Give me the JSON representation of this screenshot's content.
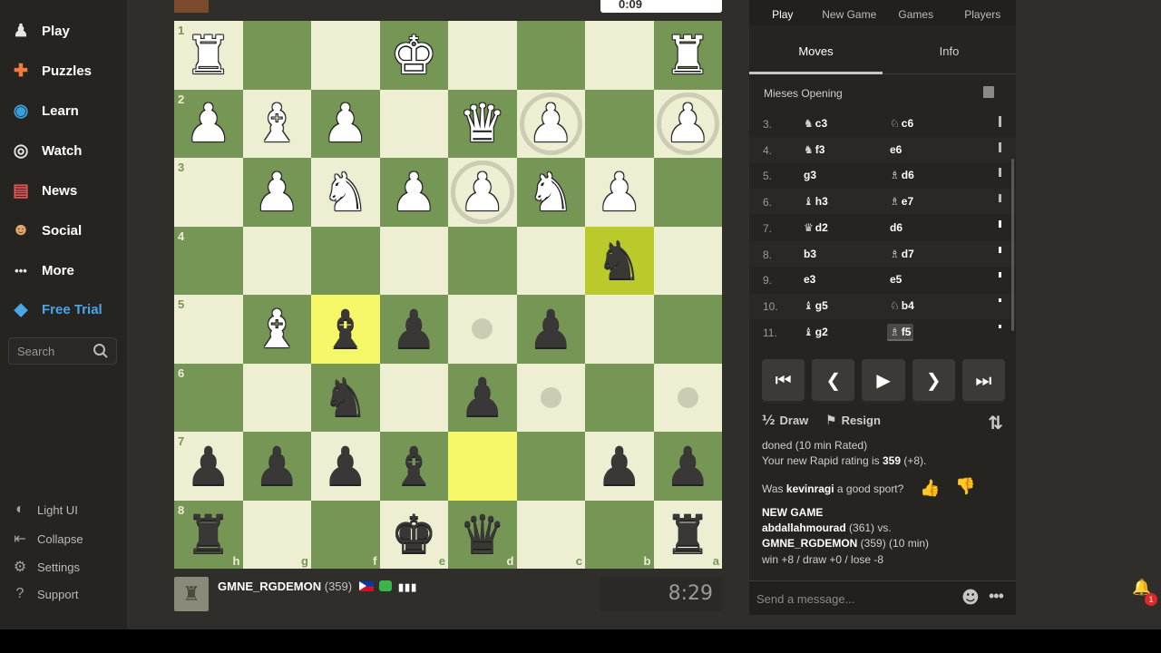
{
  "sidebar": {
    "items": [
      {
        "label": "Play",
        "icon": "play-pawn-icon",
        "glyph": "♟",
        "color": "#e6e6e6"
      },
      {
        "label": "Puzzles",
        "icon": "puzzle-icon",
        "glyph": "✚",
        "color": "#f07c3e"
      },
      {
        "label": "Learn",
        "icon": "learn-icon",
        "glyph": "◉",
        "color": "#3aa0dc"
      },
      {
        "label": "Watch",
        "icon": "binoculars-icon",
        "glyph": "◎",
        "color": "#e6e6e6"
      },
      {
        "label": "News",
        "icon": "newspaper-icon",
        "glyph": "▤",
        "color": "#e05252"
      },
      {
        "label": "Social",
        "icon": "people-icon",
        "glyph": "☻",
        "color": "#e2a76b"
      },
      {
        "label": "More",
        "icon": "more-dots-icon",
        "glyph": "•••",
        "color": "#e6e6e6"
      },
      {
        "label": "Free Trial",
        "icon": "diamond-icon",
        "glyph": "◆",
        "color": "#49a6e9"
      }
    ],
    "search_placeholder": "Search",
    "footer": [
      {
        "label": "Light UI",
        "icon": "light-ui-icon",
        "glyph": "◐"
      },
      {
        "label": "Collapse",
        "icon": "collapse-icon",
        "glyph": "⇤"
      },
      {
        "label": "Settings",
        "icon": "gear-icon",
        "glyph": "⚙"
      },
      {
        "label": "Support",
        "icon": "help-icon",
        "glyph": "?"
      }
    ]
  },
  "top_player": {
    "clock": "0:09"
  },
  "board": {
    "orientation": "black",
    "colors": {
      "light": "#eeeed2",
      "dark": "#769656",
      "highlight_light": "#f6f669",
      "highlight_dark": "#baca2b"
    },
    "rank_labels": [
      "1",
      "2",
      "3",
      "4",
      "5",
      "6",
      "7",
      "8"
    ],
    "file_labels": [
      "h",
      "g",
      "f",
      "e",
      "d",
      "c",
      "b",
      "a"
    ],
    "pieces": [
      {
        "sq": "h1",
        "glyph": "♜",
        "color": "white",
        "name": "white-rook"
      },
      {
        "sq": "e1",
        "glyph": "♚",
        "color": "white",
        "name": "white-king"
      },
      {
        "sq": "a1",
        "glyph": "♜",
        "color": "white",
        "name": "white-rook"
      },
      {
        "sq": "h2",
        "glyph": "♟",
        "color": "white",
        "name": "white-pawn"
      },
      {
        "sq": "g2",
        "glyph": "♝",
        "color": "white",
        "name": "white-bishop"
      },
      {
        "sq": "f2",
        "glyph": "♟",
        "color": "white",
        "name": "white-pawn"
      },
      {
        "sq": "d2",
        "glyph": "♛",
        "color": "white",
        "name": "white-queen"
      },
      {
        "sq": "c2",
        "glyph": "♟",
        "color": "white",
        "name": "white-pawn"
      },
      {
        "sq": "a2",
        "glyph": "♟",
        "color": "white",
        "name": "white-pawn"
      },
      {
        "sq": "g3",
        "glyph": "♟",
        "color": "white",
        "name": "white-pawn"
      },
      {
        "sq": "f3",
        "glyph": "♞",
        "color": "white",
        "name": "white-knight"
      },
      {
        "sq": "e3",
        "glyph": "♟",
        "color": "white",
        "name": "white-pawn"
      },
      {
        "sq": "d3",
        "glyph": "♟",
        "color": "white",
        "name": "white-pawn"
      },
      {
        "sq": "c3",
        "glyph": "♞",
        "color": "white",
        "name": "white-knight"
      },
      {
        "sq": "b3",
        "glyph": "♟",
        "color": "white",
        "name": "white-pawn"
      },
      {
        "sq": "g5",
        "glyph": "♝",
        "color": "white",
        "name": "white-bishop"
      },
      {
        "sq": "b4",
        "glyph": "♞",
        "color": "black",
        "name": "black-knight"
      },
      {
        "sq": "f5",
        "glyph": "♝",
        "color": "black",
        "name": "black-bishop"
      },
      {
        "sq": "e5",
        "glyph": "♟",
        "color": "black",
        "name": "black-pawn"
      },
      {
        "sq": "c5",
        "glyph": "♟",
        "color": "black",
        "name": "black-pawn"
      },
      {
        "sq": "f6",
        "glyph": "♞",
        "color": "black",
        "name": "black-knight"
      },
      {
        "sq": "d6",
        "glyph": "♟",
        "color": "black",
        "name": "black-pawn"
      },
      {
        "sq": "h7",
        "glyph": "♟",
        "color": "black",
        "name": "black-pawn"
      },
      {
        "sq": "g7",
        "glyph": "♟",
        "color": "black",
        "name": "black-pawn"
      },
      {
        "sq": "f7",
        "glyph": "♟",
        "color": "black",
        "name": "black-pawn"
      },
      {
        "sq": "e7",
        "glyph": "♝",
        "color": "black",
        "name": "black-bishop"
      },
      {
        "sq": "b7",
        "glyph": "♟",
        "color": "black",
        "name": "black-pawn"
      },
      {
        "sq": "a7",
        "glyph": "♟",
        "color": "black",
        "name": "black-pawn"
      },
      {
        "sq": "h8",
        "glyph": "♜",
        "color": "black",
        "name": "black-rook"
      },
      {
        "sq": "e8",
        "glyph": "♚",
        "color": "black",
        "name": "black-king"
      },
      {
        "sq": "d8",
        "glyph": "♛",
        "color": "black",
        "name": "black-queen"
      },
      {
        "sq": "a8",
        "glyph": "♜",
        "color": "black",
        "name": "black-rook"
      }
    ],
    "highlights": [
      "b4",
      "f5",
      "d7"
    ],
    "hint_dots": [
      "d5",
      "c6",
      "a6"
    ],
    "hint_rings": [
      "c2",
      "a2",
      "d3"
    ]
  },
  "bottom_player": {
    "name": "GMNE_RGDEMON",
    "rating": "(359)",
    "bars": "▮▮▮",
    "clock": "8:29"
  },
  "panel": {
    "top_tabs": [
      "Play",
      "New Game",
      "Games",
      "Players"
    ],
    "subtabs": [
      "Moves",
      "Info"
    ],
    "opening": "Mieses Opening",
    "moves": [
      {
        "n": "3.",
        "wg": "♞",
        "w": "c3",
        "bg": "♘",
        "b": "c6",
        "eval": 0.55
      },
      {
        "n": "4.",
        "wg": "♞",
        "w": "f3",
        "bg": "",
        "b": "e6",
        "eval": 0.5
      },
      {
        "n": "5.",
        "wg": "",
        "w": "g3",
        "bg": "♗",
        "b": "d6",
        "eval": 0.45
      },
      {
        "n": "6.",
        "wg": "♝",
        "w": "h3",
        "bg": "♗",
        "b": "e7",
        "eval": 0.4
      },
      {
        "n": "7.",
        "wg": "♛",
        "w": "d2",
        "bg": "",
        "b": "d6",
        "eval": 0.35
      },
      {
        "n": "8.",
        "wg": "",
        "w": "b3",
        "bg": "♗",
        "b": "d7",
        "eval": 0.3
      },
      {
        "n": "9.",
        "wg": "",
        "w": "e3",
        "bg": "",
        "b": "e5",
        "eval": 0.25
      },
      {
        "n": "10.",
        "wg": "♝",
        "w": "g5",
        "bg": "♘",
        "b": "b4",
        "eval": 0.2
      },
      {
        "n": "11.",
        "wg": "♝",
        "w": "g2",
        "bg": "♗",
        "b": "f5",
        "eval": 0.15
      }
    ],
    "current_move": "11...f5",
    "controls": [
      {
        "name": "first-move-button",
        "glyph": "⏮"
      },
      {
        "name": "previous-move-button",
        "glyph": "❮"
      },
      {
        "name": "play-button",
        "glyph": "▶"
      },
      {
        "name": "next-move-button",
        "glyph": "❯"
      },
      {
        "name": "last-move-button",
        "glyph": "⏭"
      }
    ],
    "draw_label": "Draw",
    "draw_glyph": "½",
    "resign_label": "Resign",
    "resign_glyph": "⚑",
    "flip_glyph": "⇅",
    "chat": {
      "line1": "doned (10 min Rated)",
      "rating_prefix": "Your new Rapid rating is ",
      "rating_value": "359",
      "rating_suffix": " (+8).",
      "sport_prefix": "Was ",
      "sport_name": "kevinragi",
      "sport_suffix": " a good sport?",
      "new_game": "NEW GAME",
      "players_a": "abdallahmourad",
      "players_a_suffix": " (361) vs.",
      "players_b": "GMNE_RGDEMON",
      "players_b_suffix": " (359) (10 min)",
      "result": "win +8 / draw +0 / lose -8",
      "thumbs_up": "👍",
      "thumbs_down": "👎"
    },
    "message_placeholder": "Send a message...",
    "emoji_glyph": "☻",
    "more_glyph": "•••"
  },
  "notification": {
    "glyph": "🔔",
    "count": "1"
  }
}
